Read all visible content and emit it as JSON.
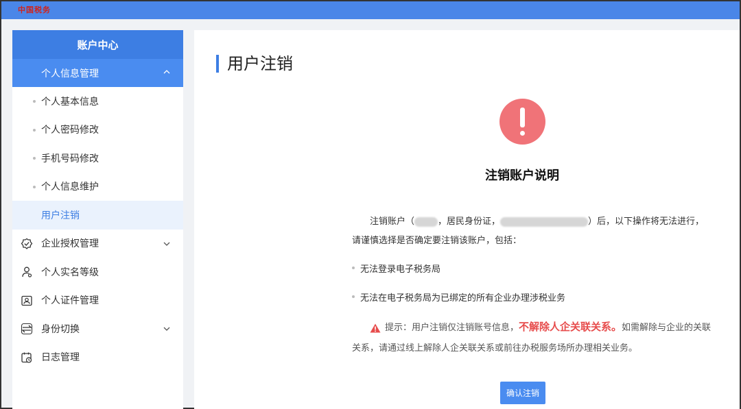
{
  "topbar": {
    "logo_text": "中国税务"
  },
  "sidebar": {
    "header": "账户中心",
    "group": {
      "label": "个人信息管理",
      "expanded": true
    },
    "sub_items": [
      {
        "label": "个人基本信息",
        "active": false
      },
      {
        "label": "个人密码修改",
        "active": false
      },
      {
        "label": "手机号码修改",
        "active": false
      },
      {
        "label": "个人信息维护",
        "active": false
      },
      {
        "label": "用户注销",
        "active": true
      }
    ],
    "nav_items": [
      {
        "label": "企业授权管理",
        "icon": "shield-check-icon",
        "has_children": true
      },
      {
        "label": "个人实名等级",
        "icon": "person-icon",
        "has_children": false
      },
      {
        "label": "个人证件管理",
        "icon": "id-card-icon",
        "has_children": false
      },
      {
        "label": "身份切换",
        "icon": "switch-icon",
        "has_children": true
      },
      {
        "label": "日志管理",
        "icon": "calendar-clock-icon",
        "has_children": false
      }
    ]
  },
  "main": {
    "title": "用户注销",
    "section_title": "注销账户说明",
    "desc_part1": "注销账户（",
    "desc_part2": "，居民身份证，",
    "desc_part3": "）后，以下操作将无法进行，请谨慎选择是否确定要注销该账户，包括：",
    "bullets": [
      "无法登录电子税务局",
      "无法在电子税务局为已绑定的所有企业办理涉税业务"
    ],
    "tip_prefix": "提示：用户注销仅注销账号信息，",
    "tip_strong": "不解除人企关联关系。",
    "tip_suffix": "如需解除与企业的关联关系，请通过线上解除人企关联关系或前往办税服务场所办理相关业务。",
    "confirm_label": "确认注销"
  },
  "colors": {
    "primary": "#3d7ee3",
    "warning": "#f07378",
    "emphasis": "#e74c4c"
  }
}
